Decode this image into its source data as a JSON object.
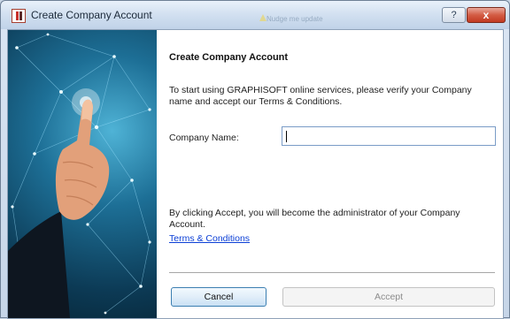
{
  "window": {
    "title": "Create Company Account",
    "background_hint": "Nudge me update",
    "help_label": "?",
    "close_label": "x"
  },
  "dialog": {
    "heading": "Create Company Account",
    "intro": "To start using GRAPHISOFT online services, please verify your Company name and accept our Terms & Conditions.",
    "company_name_label": "Company Name:",
    "company_name_value": "",
    "disclaimer": "By clicking Accept, you will become the administrator of your Company Account.",
    "terms_link": "Terms & Conditions",
    "cancel_label": "Cancel",
    "accept_label": "Accept"
  },
  "colors": {
    "link": "#0b3fd6",
    "close_button": "#c23a22",
    "focus_border": "#3c7fb1"
  }
}
